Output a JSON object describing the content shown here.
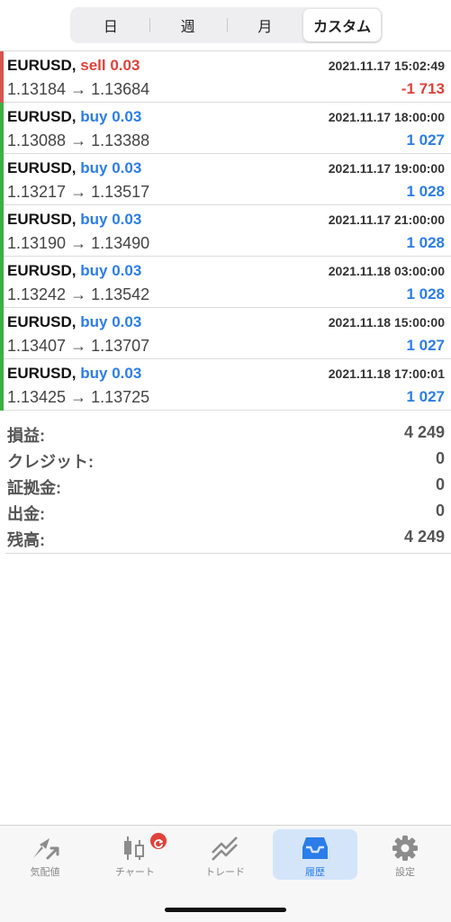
{
  "segments": [
    {
      "label": "日",
      "active": false
    },
    {
      "label": "週",
      "active": false
    },
    {
      "label": "月",
      "active": false
    },
    {
      "label": "カスタム",
      "active": true
    }
  ],
  "trades": [
    {
      "symbol": "EURUSD,",
      "side": "sell 0.03",
      "side_type": "sell",
      "time": "2021.11.17 15:02:49",
      "prices": "1.13184 → 1.13684",
      "profit": "-1 713",
      "profit_sign": "neg"
    },
    {
      "symbol": "EURUSD,",
      "side": "buy 0.03",
      "side_type": "buy",
      "time": "2021.11.17 18:00:00",
      "prices": "1.13088 → 1.13388",
      "profit": "1 027",
      "profit_sign": "pos"
    },
    {
      "symbol": "EURUSD,",
      "side": "buy 0.03",
      "side_type": "buy",
      "time": "2021.11.17 19:00:00",
      "prices": "1.13217 → 1.13517",
      "profit": "1 028",
      "profit_sign": "pos"
    },
    {
      "symbol": "EURUSD,",
      "side": "buy 0.03",
      "side_type": "buy",
      "time": "2021.11.17 21:00:00",
      "prices": "1.13190 → 1.13490",
      "profit": "1 028",
      "profit_sign": "pos"
    },
    {
      "symbol": "EURUSD,",
      "side": "buy 0.03",
      "side_type": "buy",
      "time": "2021.11.18 03:00:00",
      "prices": "1.13242 → 1.13542",
      "profit": "1 028",
      "profit_sign": "pos"
    },
    {
      "symbol": "EURUSD,",
      "side": "buy 0.03",
      "side_type": "buy",
      "time": "2021.11.18 15:00:00",
      "prices": "1.13407 → 1.13707",
      "profit": "1 027",
      "profit_sign": "pos"
    },
    {
      "symbol": "EURUSD,",
      "side": "buy 0.03",
      "side_type": "buy",
      "time": "2021.11.18 17:00:01",
      "prices": "1.13425 → 1.13725",
      "profit": "1 027",
      "profit_sign": "pos"
    }
  ],
  "summary": [
    {
      "label": "損益:",
      "value": "4 249"
    },
    {
      "label": "クレジット:",
      "value": "0"
    },
    {
      "label": "証拠金:",
      "value": "0"
    },
    {
      "label": "出金:",
      "value": "0"
    },
    {
      "label": "残高:",
      "value": "4 249"
    }
  ],
  "tabs": [
    {
      "label": "気配値",
      "icon": "quotes-icon",
      "active": false
    },
    {
      "label": "チャート",
      "icon": "chart-icon",
      "active": false
    },
    {
      "label": "トレード",
      "icon": "trade-icon",
      "active": false
    },
    {
      "label": "履歴",
      "icon": "history-icon",
      "active": true
    },
    {
      "label": "設定",
      "icon": "settings-icon",
      "active": false
    }
  ],
  "colors": {
    "sell": "#e0413a",
    "buy": "#2b7de9",
    "active_tab_bg": "#d4e5fa"
  }
}
